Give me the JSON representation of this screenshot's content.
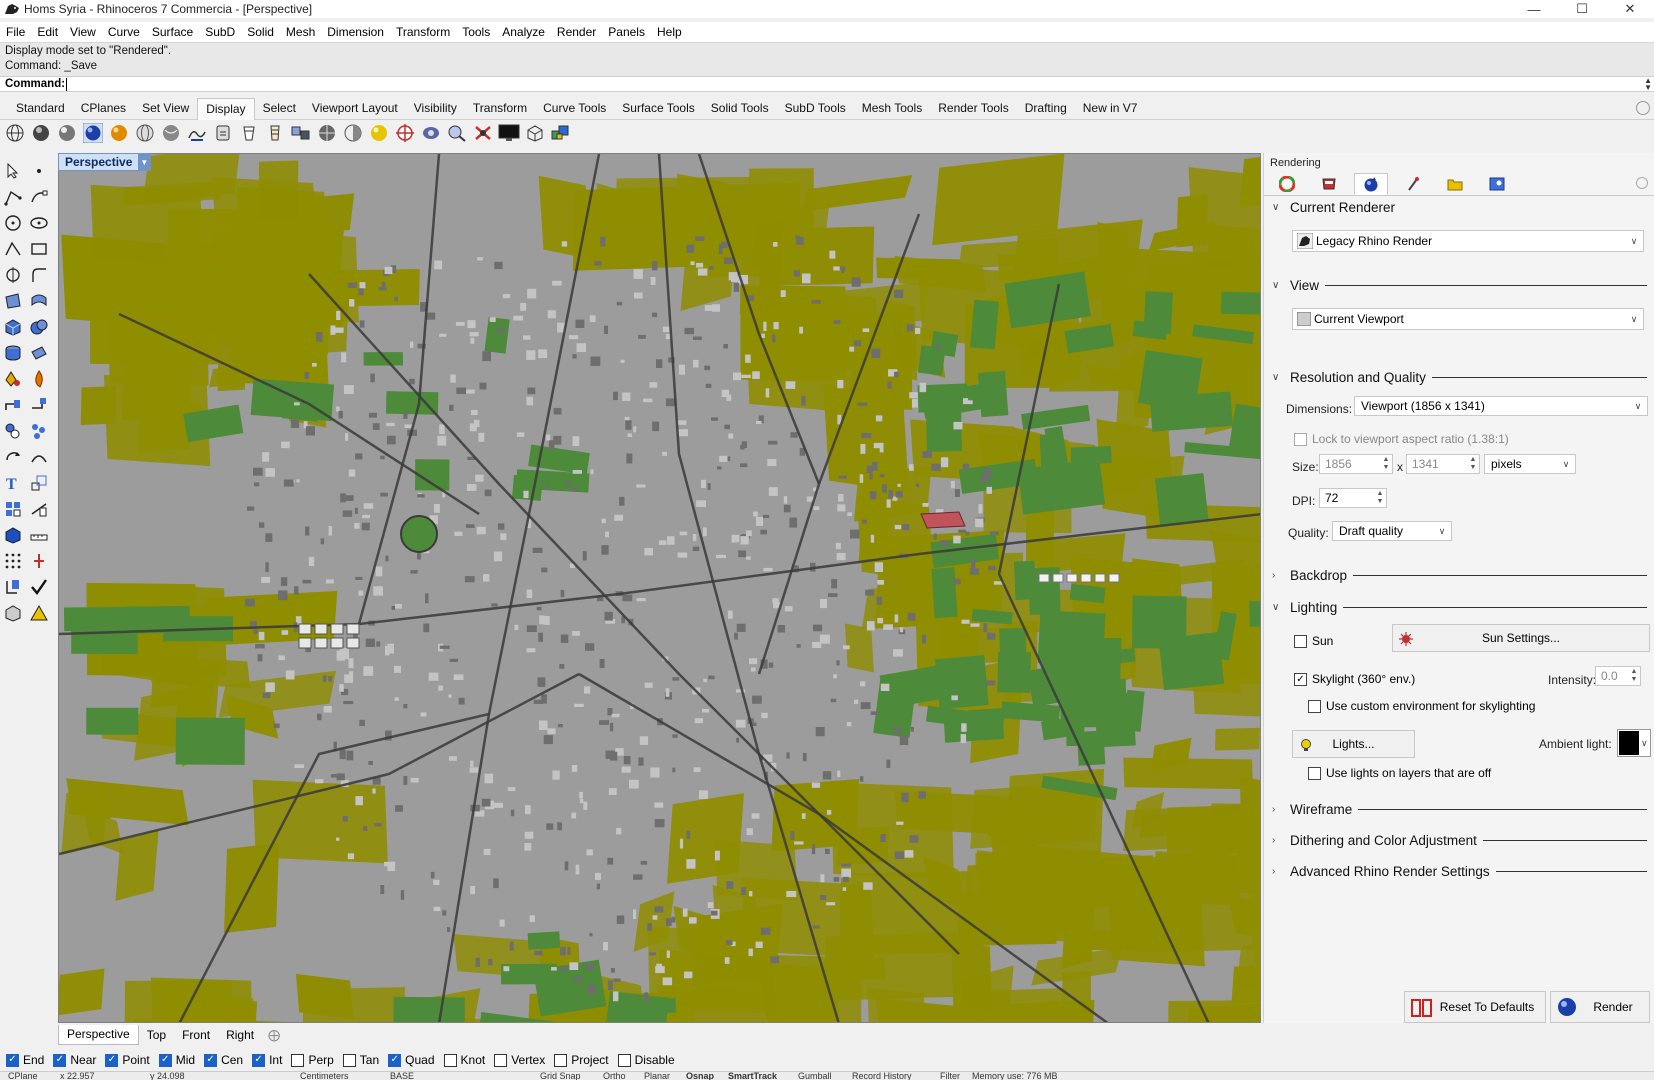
{
  "window": {
    "title": "Homs Syria - Rhinoceros 7 Commercia - [Perspective]",
    "controls": [
      "minimize-icon",
      "maximize-icon",
      "close-icon"
    ]
  },
  "menu": [
    "File",
    "Edit",
    "View",
    "Curve",
    "Surface",
    "SubD",
    "Solid",
    "Mesh",
    "Dimension",
    "Transform",
    "Tools",
    "Analyze",
    "Render",
    "Panels",
    "Help"
  ],
  "command_history": {
    "line1": "Display mode set to \"Rendered\".",
    "line2": "Command: _Save",
    "prompt_label": "Command:",
    "prompt_value": ""
  },
  "tool_tabs": [
    "Standard",
    "CPlanes",
    "Set View",
    "Display",
    "Select",
    "Viewport Layout",
    "Visibility",
    "Transform",
    "Curve Tools",
    "Surface Tools",
    "Solid Tools",
    "SubD Tools",
    "Mesh Tools",
    "Render Tools",
    "Drafting",
    "New in V7"
  ],
  "active_tool_tab": "Display",
  "viewport": {
    "label": "Perspective",
    "tabs": [
      "Perspective",
      "Top",
      "Front",
      "Right"
    ],
    "active_tab": "Perspective",
    "colors": {
      "urban": "#9c9c9c",
      "olive": "#8f8d00",
      "green": "#4d8a3a",
      "road": "#3a3a3a",
      "highlight": "#c0545a"
    }
  },
  "osnaps": [
    {
      "label": "End",
      "checked": true
    },
    {
      "label": "Near",
      "checked": true
    },
    {
      "label": "Point",
      "checked": true
    },
    {
      "label": "Mid",
      "checked": true
    },
    {
      "label": "Cen",
      "checked": true
    },
    {
      "label": "Int",
      "checked": true
    },
    {
      "label": "Perp",
      "checked": false
    },
    {
      "label": "Tan",
      "checked": false
    },
    {
      "label": "Quad",
      "checked": true
    },
    {
      "label": "Knot",
      "checked": false
    },
    {
      "label": "Vertex",
      "checked": false
    },
    {
      "label": "Project",
      "checked": false
    },
    {
      "label": "Disable",
      "checked": false
    }
  ],
  "statusbar": {
    "cplane": "CPlane",
    "x": "x 22.957",
    "y": "y 24.098",
    "units": "Centimeters",
    "layer": "BASE",
    "grid_snap": "Grid Snap",
    "ortho": "Ortho",
    "planar": "Planar",
    "osnap": "Osnap",
    "smarttrack": "SmartTrack",
    "gumball": "Gumball",
    "record_history": "Record History",
    "filter": "Filter",
    "memory": "Memory use: 776 MB"
  },
  "panel": {
    "title": "Rendering",
    "tabs": [
      "color-wheel-icon",
      "material-icon",
      "render-settings-icon",
      "paint-icon",
      "folder-icon",
      "image-icon"
    ],
    "current_renderer": {
      "header": "Current Renderer",
      "value": "Legacy Rhino Render"
    },
    "view": {
      "header": "View",
      "value": "Current Viewport"
    },
    "resolution": {
      "header": "Resolution and Quality",
      "dimensions_label": "Dimensions:",
      "dimensions_value": "Viewport (1856 x 1341)",
      "lock_label": "Lock to viewport aspect ratio (1.38:1)",
      "size_label": "Size:",
      "width": "1856",
      "x": "x",
      "height": "1341",
      "units": "pixels",
      "dpi_label": "DPI:",
      "dpi": "72",
      "quality_label": "Quality:",
      "quality": "Draft quality"
    },
    "backdrop": {
      "header": "Backdrop"
    },
    "lighting": {
      "header": "Lighting",
      "sun_label": "Sun",
      "sun_checked": false,
      "sun_settings": "Sun Settings...",
      "skylight_label": "Skylight (360° env.)",
      "skylight_checked": true,
      "intensity_label": "Intensity:",
      "intensity": "0.0",
      "custom_env_label": "Use custom environment for skylighting",
      "lights_button": "Lights...",
      "ambient_label": "Ambient light:",
      "ambient_color": "#000000",
      "lights_off_label": "Use lights on layers that are off"
    },
    "collapsed_sections": [
      "Wireframe",
      "Dithering and Color Adjustment",
      "Advanced Rhino Render Settings"
    ],
    "footer": {
      "reset": "Reset To Defaults",
      "render": "Render"
    }
  }
}
